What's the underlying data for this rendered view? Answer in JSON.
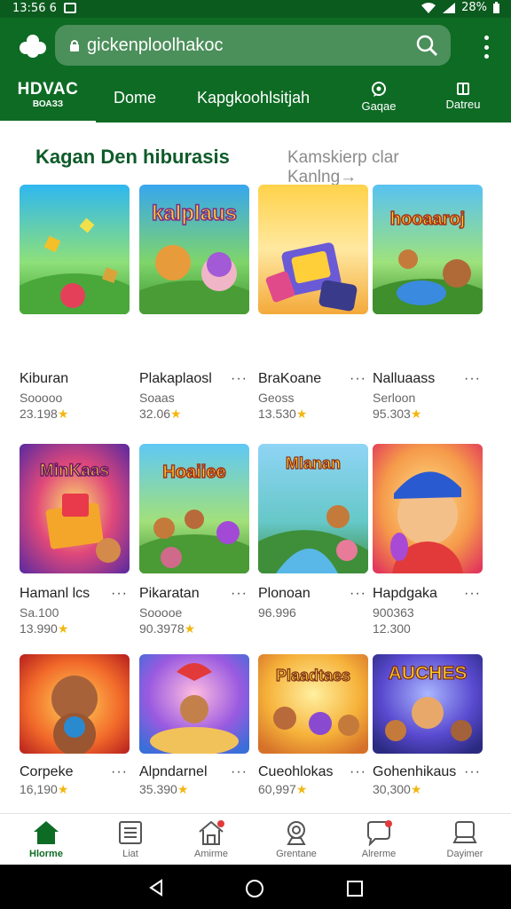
{
  "status": {
    "time": "13:56 6",
    "battery": "28%"
  },
  "browser": {
    "url": "gickenploolhakoc"
  },
  "tabs": {
    "main_label": "HDVAC",
    "main_sub": "ВОАЗЗ",
    "items": [
      {
        "label": "Dome"
      },
      {
        "label": "Kapgkoohlsitjah"
      }
    ],
    "icon_items": [
      {
        "label": "Gaqae",
        "icon": "chat-icon"
      },
      {
        "label": "Datreu",
        "icon": "book-icon"
      }
    ]
  },
  "section": {
    "title": "Kagan Den hiburasis",
    "links": [
      "Kamskierp clar",
      "Kanlng→"
    ]
  },
  "cards": [
    {
      "name": "Kiburan",
      "sub": "Sooooo",
      "rating": "23.198",
      "thumb_text": ""
    },
    {
      "name": "Plakaplaosl",
      "sub": "Soaas",
      "rating": "32.06",
      "thumb_text": "kalplaus"
    },
    {
      "name": "BraKoane",
      "sub": "Geoss",
      "rating": "13.530",
      "thumb_text": ""
    },
    {
      "name": "Nalluaass",
      "sub": "Serloon",
      "rating": "95.303",
      "thumb_text": "hooaaroj"
    },
    {
      "name": "Hamanl lcs",
      "sub": "Sa.100",
      "rating": "13.990",
      "thumb_text": "MinKaas"
    },
    {
      "name": "Pikaratan",
      "sub": "Sooooe",
      "rating": "90.3978",
      "thumb_text": "Hoaiiee"
    },
    {
      "name": "Plonoan",
      "sub": "96.996",
      "rating": "",
      "thumb_text": "Mlanan"
    },
    {
      "name": "Hapdgaka",
      "sub": "900363",
      "rating": "12.300",
      "thumb_text": ""
    },
    {
      "name": "Corpeke",
      "sub": "",
      "rating": "16,190",
      "thumb_text": ""
    },
    {
      "name": "Alpndarnel",
      "sub": "",
      "rating": "35.390",
      "thumb_text": ""
    },
    {
      "name": "Cueohlokas",
      "sub": "",
      "rating": "60,997",
      "thumb_text": "Plaadtaes"
    },
    {
      "name": "Gohenhikaus",
      "sub": "",
      "rating": "30,300",
      "thumb_text": "AUCHES"
    }
  ],
  "bottom_nav": [
    {
      "label": "Hlorme",
      "icon": "home-icon",
      "active": true
    },
    {
      "label": "Liat",
      "icon": "list-icon",
      "active": false
    },
    {
      "label": "Amirme",
      "icon": "house-badge-icon",
      "active": false
    },
    {
      "label": "Grentane",
      "icon": "profile-icon",
      "active": false
    },
    {
      "label": "Alrerme",
      "icon": "chat-badge-icon",
      "active": false
    },
    {
      "label": "Dayimer",
      "icon": "device-icon",
      "active": false
    }
  ],
  "colors": {
    "brand_green": "#0e6b24",
    "title_green": "#0e5b2a",
    "star": "#f3b712"
  }
}
